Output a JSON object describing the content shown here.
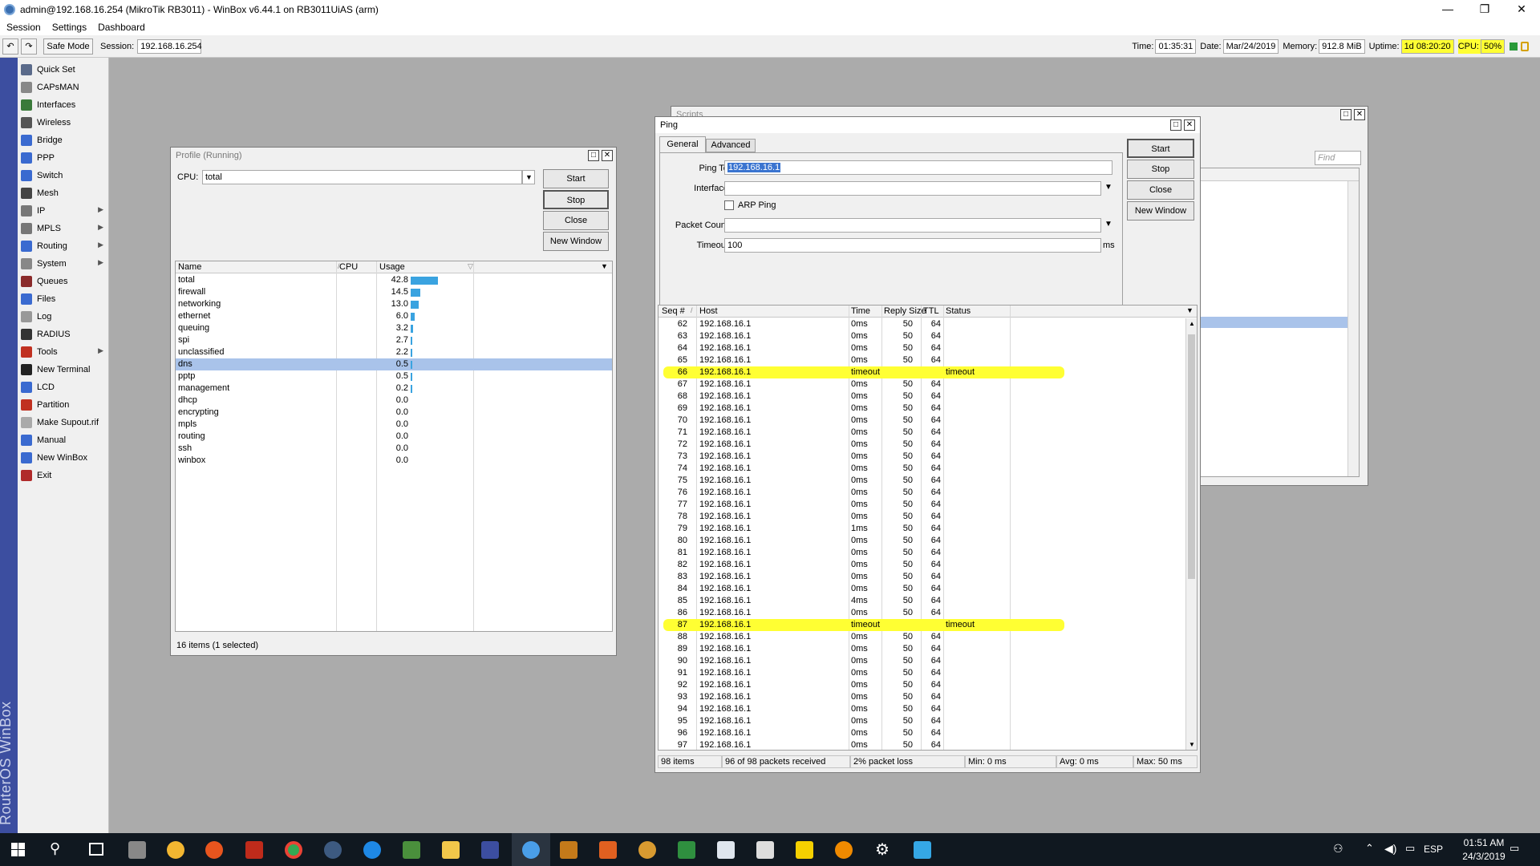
{
  "app": {
    "title": "admin@192.168.16.254 (MikroTik RB3011) - WinBox v6.44.1 on RB3011UiAS (arm)",
    "window_controls": [
      "—",
      "❐",
      "✕"
    ]
  },
  "menu": [
    "Session",
    "Settings",
    "Dashboard"
  ],
  "toolbar": {
    "undo": "↶",
    "redo": "↷",
    "safe_mode": "Safe Mode",
    "session_label": "Session:",
    "session_value": "192.168.16.254"
  },
  "status": {
    "time_label": "Time:",
    "time": "01:35:31",
    "date_label": "Date:",
    "date": "Mar/24/2019",
    "memory_label": "Memory:",
    "memory": "912.8 MiB",
    "uptime_label": "Uptime:",
    "uptime": "1d 08:20:20",
    "cpu_label": "CPU:",
    "cpu": "50%"
  },
  "brand_vertical": "RouterOS WinBox",
  "sidebar": [
    {
      "label": "Quick Set",
      "icon": "quick-set-icon",
      "sub": false
    },
    {
      "label": "CAPsMAN",
      "icon": "capsman-icon",
      "sub": false
    },
    {
      "label": "Interfaces",
      "icon": "interfaces-icon",
      "sub": false
    },
    {
      "label": "Wireless",
      "icon": "wireless-icon",
      "sub": false
    },
    {
      "label": "Bridge",
      "icon": "bridge-icon",
      "sub": false
    },
    {
      "label": "PPP",
      "icon": "ppp-icon",
      "sub": false
    },
    {
      "label": "Switch",
      "icon": "switch-icon",
      "sub": false
    },
    {
      "label": "Mesh",
      "icon": "mesh-icon",
      "sub": false
    },
    {
      "label": "IP",
      "icon": "ip-icon",
      "sub": true
    },
    {
      "label": "MPLS",
      "icon": "mpls-icon",
      "sub": true
    },
    {
      "label": "Routing",
      "icon": "routing-icon",
      "sub": true
    },
    {
      "label": "System",
      "icon": "system-icon",
      "sub": true
    },
    {
      "label": "Queues",
      "icon": "queues-icon",
      "sub": false
    },
    {
      "label": "Files",
      "icon": "files-icon",
      "sub": false
    },
    {
      "label": "Log",
      "icon": "log-icon",
      "sub": false
    },
    {
      "label": "RADIUS",
      "icon": "radius-icon",
      "sub": false
    },
    {
      "label": "Tools",
      "icon": "tools-icon",
      "sub": true
    },
    {
      "label": "New Terminal",
      "icon": "terminal-icon",
      "sub": false
    },
    {
      "label": "LCD",
      "icon": "lcd-icon",
      "sub": false
    },
    {
      "label": "Partition",
      "icon": "partition-icon",
      "sub": false
    },
    {
      "label": "Make Supout.rif",
      "icon": "supout-icon",
      "sub": false
    },
    {
      "label": "Manual",
      "icon": "manual-icon",
      "sub": false
    },
    {
      "label": "New WinBox",
      "icon": "winbox-icon",
      "sub": false
    },
    {
      "label": "Exit",
      "icon": "exit-icon",
      "sub": false
    }
  ],
  "profile": {
    "title": "Profile (Running)",
    "cpu_label": "CPU:",
    "cpu_value": "total",
    "buttons": [
      "Start",
      "Stop",
      "Close",
      "New Window"
    ],
    "columns": [
      "Name",
      "CPU",
      "Usage"
    ],
    "rows": [
      {
        "name": "total",
        "usage": "42.8"
      },
      {
        "name": "firewall",
        "usage": "14.5"
      },
      {
        "name": "networking",
        "usage": "13.0"
      },
      {
        "name": "ethernet",
        "usage": "6.0"
      },
      {
        "name": "queuing",
        "usage": "3.2"
      },
      {
        "name": "spi",
        "usage": "2.7"
      },
      {
        "name": "unclassified",
        "usage": "2.2"
      },
      {
        "name": "dns",
        "usage": "0.5"
      },
      {
        "name": "pptp",
        "usage": "0.5"
      },
      {
        "name": "management",
        "usage": "0.2"
      },
      {
        "name": "dhcp",
        "usage": "0.0"
      },
      {
        "name": "encrypting",
        "usage": "0.0"
      },
      {
        "name": "mpls",
        "usage": "0.0"
      },
      {
        "name": "routing",
        "usage": "0.0"
      },
      {
        "name": "ssh",
        "usage": "0.0"
      },
      {
        "name": "winbox",
        "usage": "0.0"
      }
    ],
    "selected_row": "dns",
    "status": "16 items (1 selected)"
  },
  "bg_window": {
    "title": "Scripts",
    "find_placeholder": "Find"
  },
  "ping": {
    "title": "Ping",
    "tabs": [
      "General",
      "Advanced"
    ],
    "ping_to_label": "Ping To:",
    "ping_to_value": "192.168.16.1",
    "interface_label": "Interface:",
    "interface_value": "",
    "arp_ping_label": "ARP Ping",
    "packet_count_label": "Packet Count:",
    "packet_count_value": "",
    "timeout_label": "Timeout:",
    "timeout_value": "100",
    "timeout_unit": "ms",
    "buttons": [
      "Start",
      "Stop",
      "Close",
      "New Window"
    ],
    "columns": [
      "Seq #",
      "Host",
      "Time",
      "Reply Size",
      "TTL",
      "Status"
    ],
    "rows": [
      {
        "seq": "62",
        "host": "192.168.16.1",
        "time": "0ms",
        "size": "50",
        "ttl": "64",
        "status": ""
      },
      {
        "seq": "63",
        "host": "192.168.16.1",
        "time": "0ms",
        "size": "50",
        "ttl": "64",
        "status": ""
      },
      {
        "seq": "64",
        "host": "192.168.16.1",
        "time": "0ms",
        "size": "50",
        "ttl": "64",
        "status": ""
      },
      {
        "seq": "65",
        "host": "192.168.16.1",
        "time": "0ms",
        "size": "50",
        "ttl": "64",
        "status": ""
      },
      {
        "seq": "66",
        "host": "192.168.16.1",
        "time": "timeout",
        "size": "",
        "ttl": "",
        "status": "timeout"
      },
      {
        "seq": "67",
        "host": "192.168.16.1",
        "time": "0ms",
        "size": "50",
        "ttl": "64",
        "status": ""
      },
      {
        "seq": "68",
        "host": "192.168.16.1",
        "time": "0ms",
        "size": "50",
        "ttl": "64",
        "status": ""
      },
      {
        "seq": "69",
        "host": "192.168.16.1",
        "time": "0ms",
        "size": "50",
        "ttl": "64",
        "status": ""
      },
      {
        "seq": "70",
        "host": "192.168.16.1",
        "time": "0ms",
        "size": "50",
        "ttl": "64",
        "status": ""
      },
      {
        "seq": "71",
        "host": "192.168.16.1",
        "time": "0ms",
        "size": "50",
        "ttl": "64",
        "status": ""
      },
      {
        "seq": "72",
        "host": "192.168.16.1",
        "time": "0ms",
        "size": "50",
        "ttl": "64",
        "status": ""
      },
      {
        "seq": "73",
        "host": "192.168.16.1",
        "time": "0ms",
        "size": "50",
        "ttl": "64",
        "status": ""
      },
      {
        "seq": "74",
        "host": "192.168.16.1",
        "time": "0ms",
        "size": "50",
        "ttl": "64",
        "status": ""
      },
      {
        "seq": "75",
        "host": "192.168.16.1",
        "time": "0ms",
        "size": "50",
        "ttl": "64",
        "status": ""
      },
      {
        "seq": "76",
        "host": "192.168.16.1",
        "time": "0ms",
        "size": "50",
        "ttl": "64",
        "status": ""
      },
      {
        "seq": "77",
        "host": "192.168.16.1",
        "time": "0ms",
        "size": "50",
        "ttl": "64",
        "status": ""
      },
      {
        "seq": "78",
        "host": "192.168.16.1",
        "time": "0ms",
        "size": "50",
        "ttl": "64",
        "status": ""
      },
      {
        "seq": "79",
        "host": "192.168.16.1",
        "time": "1ms",
        "size": "50",
        "ttl": "64",
        "status": ""
      },
      {
        "seq": "80",
        "host": "192.168.16.1",
        "time": "0ms",
        "size": "50",
        "ttl": "64",
        "status": ""
      },
      {
        "seq": "81",
        "host": "192.168.16.1",
        "time": "0ms",
        "size": "50",
        "ttl": "64",
        "status": ""
      },
      {
        "seq": "82",
        "host": "192.168.16.1",
        "time": "0ms",
        "size": "50",
        "ttl": "64",
        "status": ""
      },
      {
        "seq": "83",
        "host": "192.168.16.1",
        "time": "0ms",
        "size": "50",
        "ttl": "64",
        "status": ""
      },
      {
        "seq": "84",
        "host": "192.168.16.1",
        "time": "0ms",
        "size": "50",
        "ttl": "64",
        "status": ""
      },
      {
        "seq": "85",
        "host": "192.168.16.1",
        "time": "4ms",
        "size": "50",
        "ttl": "64",
        "status": ""
      },
      {
        "seq": "86",
        "host": "192.168.16.1",
        "time": "0ms",
        "size": "50",
        "ttl": "64",
        "status": ""
      },
      {
        "seq": "87",
        "host": "192.168.16.1",
        "time": "timeout",
        "size": "",
        "ttl": "",
        "status": "timeout"
      },
      {
        "seq": "88",
        "host": "192.168.16.1",
        "time": "0ms",
        "size": "50",
        "ttl": "64",
        "status": ""
      },
      {
        "seq": "89",
        "host": "192.168.16.1",
        "time": "0ms",
        "size": "50",
        "ttl": "64",
        "status": ""
      },
      {
        "seq": "90",
        "host": "192.168.16.1",
        "time": "0ms",
        "size": "50",
        "ttl": "64",
        "status": ""
      },
      {
        "seq": "91",
        "host": "192.168.16.1",
        "time": "0ms",
        "size": "50",
        "ttl": "64",
        "status": ""
      },
      {
        "seq": "92",
        "host": "192.168.16.1",
        "time": "0ms",
        "size": "50",
        "ttl": "64",
        "status": ""
      },
      {
        "seq": "93",
        "host": "192.168.16.1",
        "time": "0ms",
        "size": "50",
        "ttl": "64",
        "status": ""
      },
      {
        "seq": "94",
        "host": "192.168.16.1",
        "time": "0ms",
        "size": "50",
        "ttl": "64",
        "status": ""
      },
      {
        "seq": "95",
        "host": "192.168.16.1",
        "time": "0ms",
        "size": "50",
        "ttl": "64",
        "status": ""
      },
      {
        "seq": "96",
        "host": "192.168.16.1",
        "time": "0ms",
        "size": "50",
        "ttl": "64",
        "status": ""
      },
      {
        "seq": "97",
        "host": "192.168.16.1",
        "time": "0ms",
        "size": "50",
        "ttl": "64",
        "status": ""
      }
    ],
    "status": {
      "items": "98 items",
      "received": "96 of 98 packets received",
      "loss": "2% packet loss",
      "min": "Min: 0 ms",
      "avg": "Avg: 0 ms",
      "max": "Max: 50 ms"
    }
  },
  "taskbar": {
    "lang": "ESP",
    "time": "01:51 AM",
    "date": "24/3/2019"
  },
  "colors": {
    "accent": "#3c4ea0",
    "selection": "#a9c3ea",
    "highlight": "#ffff33",
    "bar": "#3aa3e0"
  }
}
